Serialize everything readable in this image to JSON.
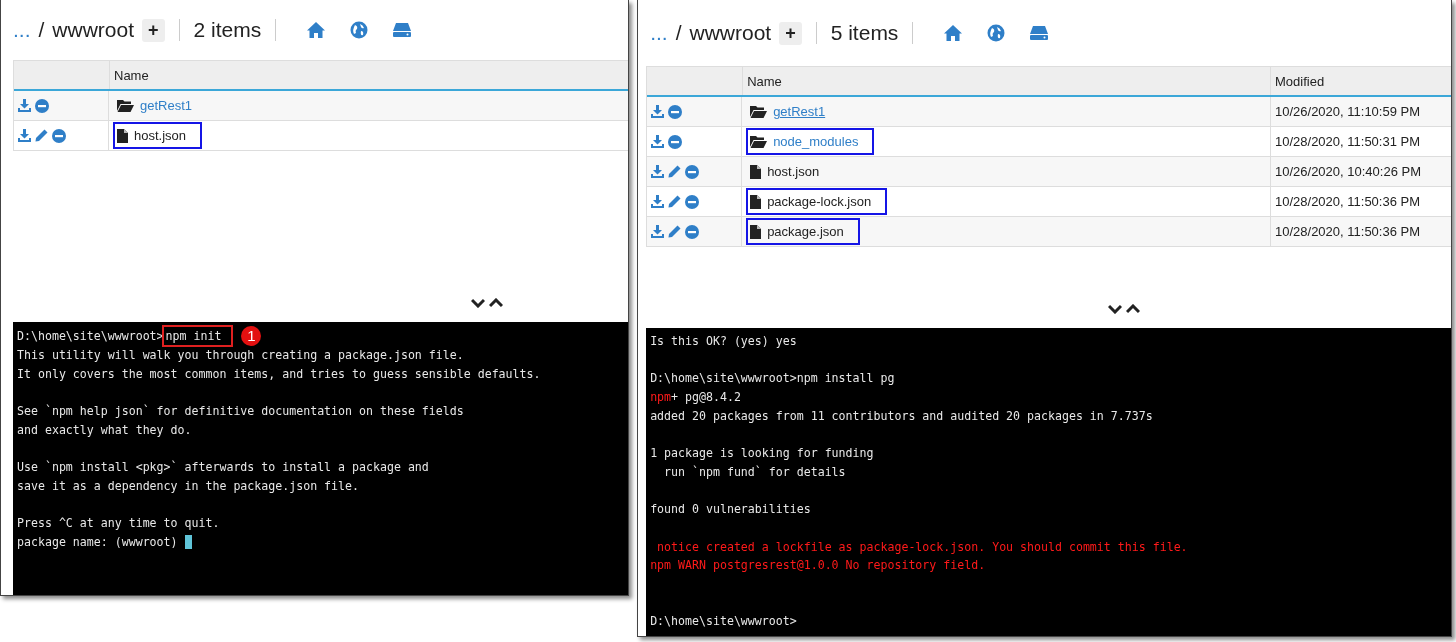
{
  "panels": [
    {
      "breadcrumb": {
        "link": "...",
        "separator": "/",
        "folder": "wwwroot"
      },
      "add_button": "+",
      "item_count": "2 items",
      "columns": [
        "Name"
      ],
      "rows": [
        {
          "kind": "folder",
          "name": "getRest1",
          "editable": false,
          "underlined": false,
          "highlighted": false
        },
        {
          "kind": "file",
          "name": "host.json",
          "editable": true,
          "underlined": false,
          "highlighted": true
        }
      ],
      "terminal": {
        "lines": [
          {
            "kind": "text",
            "segments": [
              {
                "text": "D:\\home\\site\\wwwroot>",
                "kind": "normal",
                "boxed": false
              },
              {
                "text": "npm init",
                "kind": "normal",
                "boxed": true,
                "badge": "1"
              }
            ]
          },
          {
            "kind": "text",
            "segments": [
              {
                "text": "This utility will walk you through creating a package.json file.",
                "kind": "normal",
                "boxed": false
              }
            ]
          },
          {
            "kind": "text",
            "segments": [
              {
                "text": "It only covers the most common items, and tries to guess sensible defaults.",
                "kind": "normal",
                "boxed": false
              }
            ]
          },
          {
            "kind": "blank"
          },
          {
            "kind": "text",
            "segments": [
              {
                "text": "See `npm help json` for definitive documentation on these fields",
                "kind": "normal",
                "boxed": false
              }
            ]
          },
          {
            "kind": "text",
            "segments": [
              {
                "text": "and exactly what they do.",
                "kind": "normal",
                "boxed": false
              }
            ]
          },
          {
            "kind": "blank"
          },
          {
            "kind": "text",
            "segments": [
              {
                "text": "Use `npm install <pkg>` afterwards to install a package and",
                "kind": "normal",
                "boxed": false
              }
            ]
          },
          {
            "kind": "text",
            "segments": [
              {
                "text": "save it as a dependency in the package.json file.",
                "kind": "normal",
                "boxed": false
              }
            ]
          },
          {
            "kind": "blank"
          },
          {
            "kind": "text",
            "segments": [
              {
                "text": "Press ^C at any time to quit.",
                "kind": "normal",
                "boxed": false
              }
            ]
          },
          {
            "kind": "text",
            "segments": [
              {
                "text": "package name: (wwwroot)",
                "kind": "normal",
                "boxed": false
              },
              {
                "kind": "cursor"
              }
            ]
          }
        ]
      }
    },
    {
      "breadcrumb": {
        "link": "...",
        "separator": "/",
        "folder": "wwwroot"
      },
      "add_button": "+",
      "item_count": "5 items",
      "columns": [
        "Name",
        "Modified"
      ],
      "rows": [
        {
          "kind": "folder",
          "name": "getRest1",
          "editable": false,
          "underlined": true,
          "highlighted": false,
          "modified": "10/26/2020, 11:10:59 PM"
        },
        {
          "kind": "folder",
          "name": "node_modules",
          "editable": false,
          "underlined": false,
          "highlighted": true,
          "modified": "10/28/2020, 11:50:31 PM"
        },
        {
          "kind": "file",
          "name": "host.json",
          "editable": true,
          "underlined": false,
          "highlighted": false,
          "modified": "10/26/2020, 10:40:26 PM"
        },
        {
          "kind": "file",
          "name": "package-lock.json",
          "editable": true,
          "underlined": false,
          "highlighted": true,
          "modified": "10/28/2020, 11:50:36 PM"
        },
        {
          "kind": "file",
          "name": "package.json",
          "editable": true,
          "underlined": false,
          "highlighted": true,
          "modified": "10/28/2020, 11:50:36 PM"
        }
      ],
      "terminal": {
        "lines": [
          {
            "kind": "text",
            "segments": [
              {
                "text": "Is this OK? (yes) yes",
                "kind": "normal",
                "boxed": false
              }
            ]
          },
          {
            "kind": "blank"
          },
          {
            "kind": "text",
            "segments": [
              {
                "text": "D:\\home\\site\\wwwroot>npm install pg",
                "kind": "normal",
                "boxed": false
              }
            ]
          },
          {
            "kind": "text",
            "segments": [
              {
                "text": "npm",
                "kind": "error",
                "boxed": false
              },
              {
                "text": "+ pg@8.4.2",
                "kind": "normal",
                "boxed": false
              }
            ]
          },
          {
            "kind": "text",
            "segments": [
              {
                "text": "added 20 packages from 11 contributors and audited 20 packages in 7.737s",
                "kind": "normal",
                "boxed": false
              }
            ]
          },
          {
            "kind": "blank"
          },
          {
            "kind": "text",
            "segments": [
              {
                "text": "1 package is looking for funding",
                "kind": "normal",
                "boxed": false
              }
            ]
          },
          {
            "kind": "text",
            "segments": [
              {
                "text": "  run `npm fund` for details",
                "kind": "normal",
                "boxed": false
              }
            ]
          },
          {
            "kind": "blank"
          },
          {
            "kind": "text",
            "segments": [
              {
                "text": "found 0 vulnerabilities",
                "kind": "normal",
                "boxed": false
              }
            ]
          },
          {
            "kind": "blank"
          },
          {
            "kind": "text",
            "segments": [
              {
                "text": " notice created a lockfile as package-lock.json. You should commit this file.",
                "kind": "error",
                "boxed": false
              }
            ]
          },
          {
            "kind": "text",
            "segments": [
              {
                "text": "npm WARN postgresrest@1.0.0 No repository field.",
                "kind": "error",
                "boxed": false
              }
            ]
          },
          {
            "kind": "blank"
          },
          {
            "kind": "blank"
          },
          {
            "kind": "text",
            "segments": [
              {
                "text": "D:\\home\\site\\wwwroot>",
                "kind": "normal",
                "boxed": false
              }
            ]
          }
        ]
      }
    }
  ]
}
